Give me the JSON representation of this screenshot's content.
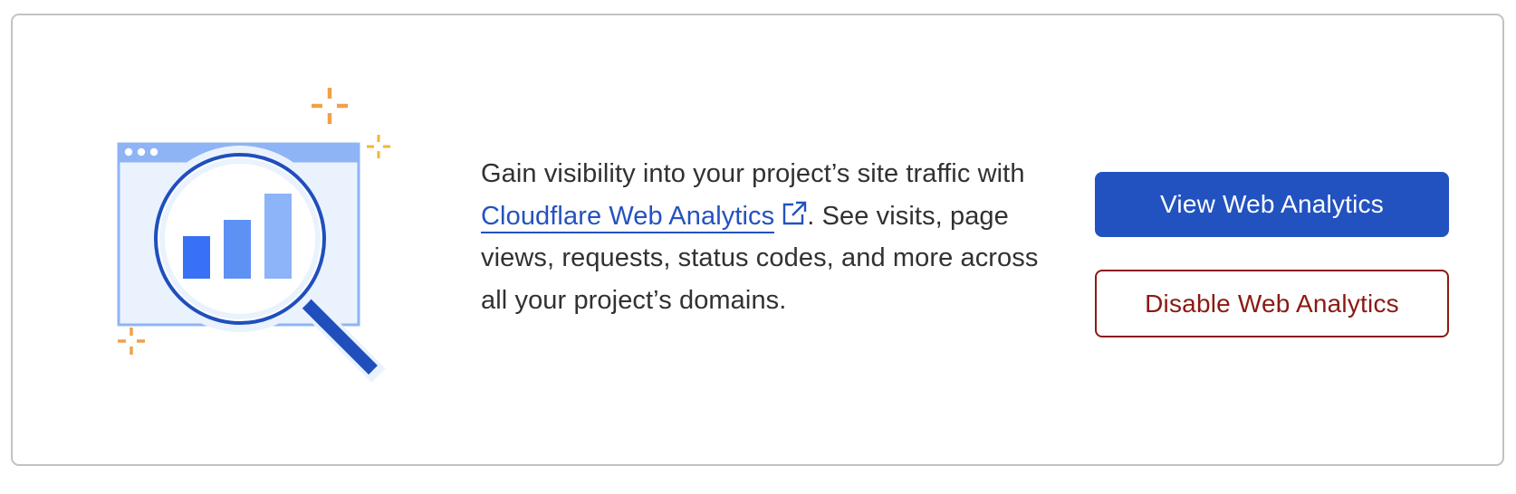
{
  "card": {
    "description_before_link": "Gain visibility into your project’s site traffic with ",
    "link_label": "Cloudflare Web Analytics",
    "description_after_link": ". See visits, page views, requests, status codes, and more across all your project’s domains.",
    "link_icon": "external-link-icon",
    "illustration_icon": "analytics-magnifier-illustration"
  },
  "actions": {
    "view_label": "View Web Analytics",
    "disable_label": "Disable Web Analytics"
  },
  "colors": {
    "primary": "#2252bf",
    "danger": "#8b1a12",
    "link": "#2452bf",
    "sparkle_orange": "#f0a14a",
    "sparkle_yellow": "#f4b531",
    "bar_dark": "#3871f6",
    "bar_mid": "#5e91f4",
    "bar_light": "#8db3f8"
  }
}
